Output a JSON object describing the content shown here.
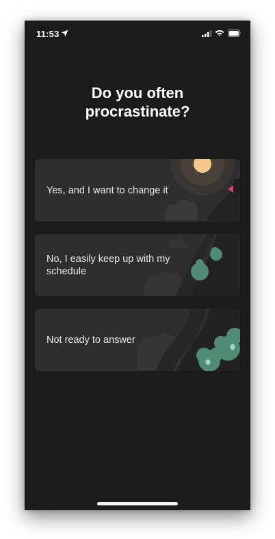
{
  "status_bar": {
    "time": "11:53",
    "location_icon": "location-arrow-icon",
    "signal_icon": "cellular-signal-icon",
    "wifi_icon": "wifi-icon",
    "battery_icon": "battery-icon"
  },
  "question": {
    "line1": "Do you often",
    "line2": "procrastinate?"
  },
  "options": [
    {
      "label": "Yes, and I want to change it"
    },
    {
      "label": "No, I easily keep up with my schedule"
    },
    {
      "label": "Not ready to answer"
    }
  ],
  "colors": {
    "background": "#1b1b1b",
    "card": "#2e2e2e",
    "sun": "#f2c98b",
    "tree": "#4f8c73",
    "flag": "#d8456b"
  }
}
